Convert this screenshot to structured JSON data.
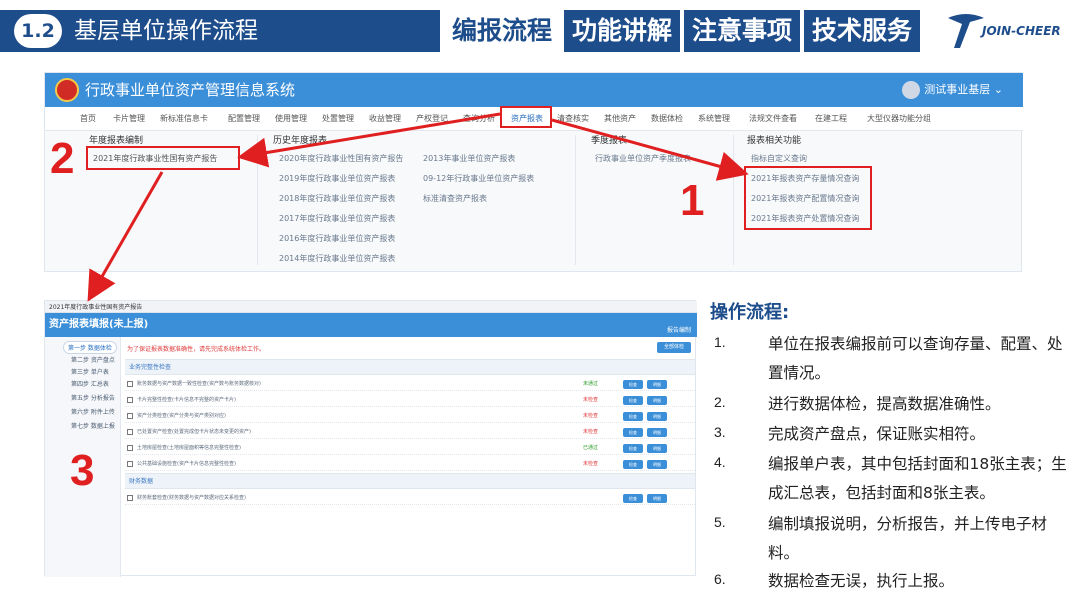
{
  "banner": {
    "section_number": "1.2",
    "section_title": "基层单位操作流程",
    "tabs": [
      "编报流程",
      "功能讲解",
      "注意事项",
      "技术服务"
    ],
    "logo_text": "JOIN-CHEER"
  },
  "system": {
    "title": "行政事业单位资产管理信息系统",
    "user": "测试事业基层",
    "nav": [
      "首页",
      "卡片管理",
      "新标准信息卡",
      "配置管理",
      "使用管理",
      "处置管理",
      "收益管理",
      "产权登记",
      "查询分析",
      "资产报表",
      "清查核实",
      "其他资产",
      "数据体检",
      "系统管理",
      "法规文件查看",
      "在建工程",
      "大型仪器功能分组"
    ],
    "menu": {
      "col1_title": "年度报表编制",
      "col1_items": [
        "2021年度行政事业性国有资产报告"
      ],
      "col2_title": "历史年度报表",
      "col2_items_a": [
        "2020年度行政事业性国有资产报告",
        "2019年度行政事业单位资产报表",
        "2018年度行政事业单位资产报表",
        "2017年度行政事业单位资产报表",
        "2016年度行政事业单位资产报表",
        "2014年度行政事业单位资产报表"
      ],
      "col2_items_b": [
        "2013年事业单位资产报表",
        "09-12年行政事业单位资产报表",
        "标准清查资产报表"
      ],
      "col3_title": "季度报表",
      "col3_items": [
        "行政事业单位资产季度报表"
      ],
      "col4_title": "报表相关功能",
      "col4_items": [
        "指标自定义查询",
        "2021年报表资产存量情况查询",
        "2021年报表资产配置情况查询",
        "2021年报表资产处置情况查询"
      ]
    }
  },
  "markers": [
    "1",
    "2",
    "3"
  ],
  "form": {
    "tab_label": "2021年度行政事业性国有资产报告",
    "title": "资产报表填报(未上报)",
    "right_label": "报告编制",
    "steps": [
      "第一步 数据体检",
      "第二步 资产盘点",
      "第三步 单户表",
      "第四步 汇总表",
      "第五步 分析报告",
      "第六步 附件上传",
      "第七步 数据上报"
    ],
    "warning": "为了保证报表数据准确性，请先完成系统体检工作。",
    "top_button": "全部体检",
    "group1": "业务完整性检查",
    "rows": [
      {
        "text": "账务数据与资产数据一致性检查(资产数与账务数据核对)",
        "status": "未通过",
        "status_color": "#2e9d2e"
      },
      {
        "text": "卡片完整性检查(卡片信息不完整的资产卡片)",
        "status": "未检查",
        "status_color": "#e03a3a"
      },
      {
        "text": "资产分类检查(资产分类与资产类别对应)",
        "status": "未检查",
        "status_color": "#e03a3a"
      },
      {
        "text": "已处置资产检查(处置完成但卡片状态未变更的资产)",
        "status": "未检查",
        "status_color": "#e03a3a"
      },
      {
        "text": "土地房屋检查(土地房屋面积等信息完整性检查)",
        "status": "已通过",
        "status_color": "#2e9d2e"
      },
      {
        "text": "公共基础设施检查(资产卡片信息完整性检查)",
        "status": "未检查",
        "status_color": "#e03a3a"
      }
    ],
    "row_btn1": "检查",
    "row_btn2": "明细",
    "group2": "财务数据",
    "finance_row": {
      "text": "财务账套检查(财务数据与资产数据对应关系检查)",
      "status": "",
      "status_color": "#e03a3a"
    }
  },
  "procedure": {
    "title": "操作流程:",
    "items": [
      {
        "num": "1.",
        "text": "单位在报表编报前可以查询存量、配置、处置情况。"
      },
      {
        "num": "2.",
        "text": "进行数据体检，提高数据准确性。"
      },
      {
        "num": "3.",
        "text": "完成资产盘点，保证账实相符。"
      },
      {
        "num": "4.",
        "text": "编报单户表，其中包括封面和18张主表；生成汇总表，包括封面和8张主表。"
      },
      {
        "num": "5.",
        "text": "编制填报说明，分析报告，并上传电子材料。"
      },
      {
        "num": "6.",
        "text": "数据检查无误，执行上报。"
      }
    ]
  },
  "colors": {
    "brand_blue": "#1e4d8c",
    "system_blue": "#3b8fd8",
    "marker_red": "#e02020"
  }
}
